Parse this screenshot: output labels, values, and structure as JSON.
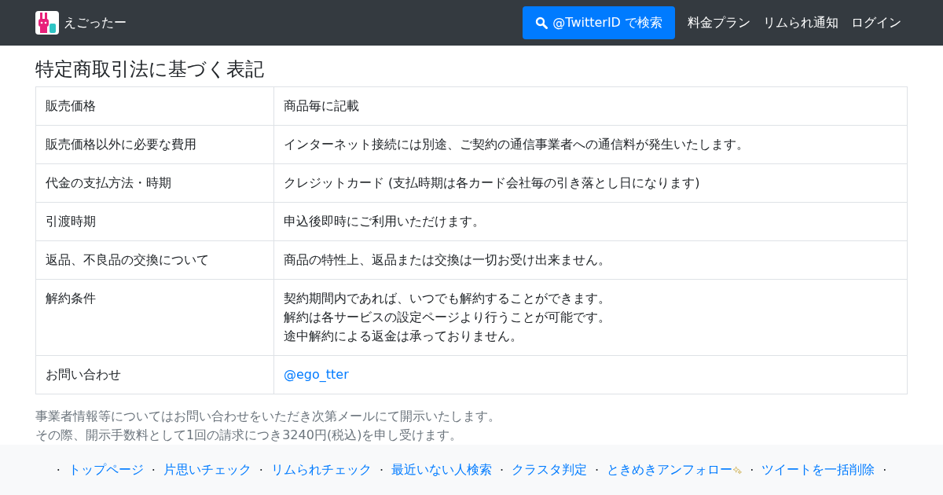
{
  "navbar": {
    "brand": "えごったー",
    "search_button": "@TwitterID で検索",
    "links": [
      "料金プラン",
      "リムられ通知",
      "ログイン"
    ]
  },
  "page_title": "特定商取引法に基づく表記",
  "table": {
    "rows": [
      {
        "label": "販売価格",
        "lines": [
          "商品毎に記載"
        ]
      },
      {
        "label": "販売価格以外に必要な費用",
        "lines": [
          "インターネット接続には別途、ご契約の通信事業者への通信料が発生いたします。"
        ]
      },
      {
        "label": "代金の支払方法・時期",
        "lines": [
          "クレジットカード (支払時期は各カード会社毎の引き落とし日になります)"
        ]
      },
      {
        "label": "引渡時期",
        "lines": [
          "申込後即時にご利用いただけます。"
        ]
      },
      {
        "label": "返品、不良品の交換について",
        "lines": [
          "商品の特性上、返品または交換は一切お受け出来ません。"
        ]
      },
      {
        "label": "解約条件",
        "lines": [
          "契約期間内であれば、いつでも解約することができます。",
          "解約は各サービスの設定ページより行うことが可能です。",
          "途中解約による返金は承っておりません。"
        ]
      },
      {
        "label": "お問い合わせ",
        "link": "@ego_tter"
      }
    ]
  },
  "notes": [
    "事業者情報等についてはお問い合わせをいただき次第メールにて開示いたします。",
    "その際、開示手数料として1回の請求につき3240円(税込)を申し受けます。"
  ],
  "footer": {
    "separator": "·",
    "links": [
      {
        "label": "トップページ",
        "sparkle": false
      },
      {
        "label": "片思いチェック",
        "sparkle": false
      },
      {
        "label": "リムられチェック",
        "sparkle": false
      },
      {
        "label": "最近いない人検索",
        "sparkle": false
      },
      {
        "label": "クラスタ判定",
        "sparkle": false
      },
      {
        "label": "ときめきアンフォロー",
        "sparkle": true
      },
      {
        "label": "ツイートを一括削除",
        "sparkle": false
      }
    ]
  }
}
